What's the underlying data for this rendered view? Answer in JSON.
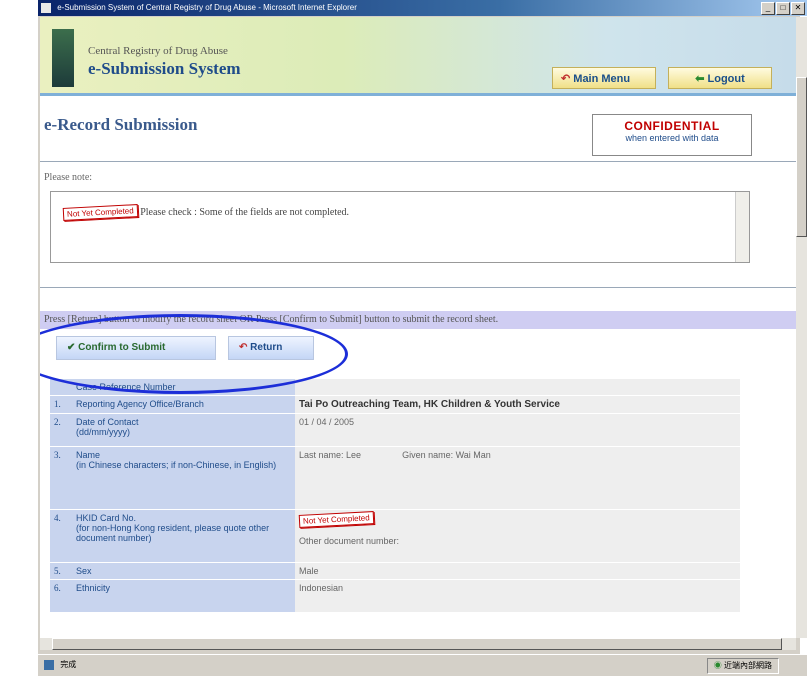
{
  "window": {
    "title": "e-Submission System of Central Registry of Drug Abuse - Microsoft Internet Explorer",
    "controls": [
      "_",
      "□",
      "✕"
    ]
  },
  "header": {
    "agency": "Central Registry of Drug Abuse",
    "system_name": "e-Submission System",
    "main_menu_label": "Main Menu",
    "logout_label": "Logout"
  },
  "page": {
    "title": "e-Record Submission",
    "confidential": "CONFIDENTIAL",
    "confidential_sub": "when entered with data",
    "note_label": "Please note:",
    "not_completed_stamp": "Not Yet Completed",
    "note_message": "Please check : Some of the fields are not completed.",
    "instruction": "Press [Return] button to modify the record sheet OR Press [Confirm to Submit] button to submit the record sheet.",
    "confirm_label": "Confirm to Submit",
    "return_label": "Return"
  },
  "form": {
    "case_ref_label": "Case Reference Number",
    "rows": [
      {
        "num": "1.",
        "label": "Reporting Agency Office/Branch",
        "sub": "",
        "value": "Tai Po Outreaching Team, HK Children & Youth Service"
      },
      {
        "num": "2.",
        "label": "Date of Contact",
        "sub": "(dd/mm/yyyy)",
        "value": "01 / 04 / 2005"
      },
      {
        "num": "3.",
        "label": "Name",
        "sub": "(in Chinese characters; if non-Chinese, in English)",
        "value_last": "Last name: Lee",
        "value_given": "Given name: Wai Man"
      },
      {
        "num": "4.",
        "label": "HKID Card No.",
        "sub": "(for non-Hong Kong resident, please quote other document number)",
        "value_stamp": "Not Yet Completed",
        "value_other": "Other document number:"
      },
      {
        "num": "5.",
        "label": "Sex",
        "sub": "",
        "value": "Male"
      },
      {
        "num": "6.",
        "label": "Ethnicity",
        "sub": "",
        "value": "Indonesian"
      }
    ]
  },
  "statusbar": {
    "text": "完成",
    "zone": "近端內部網路"
  }
}
